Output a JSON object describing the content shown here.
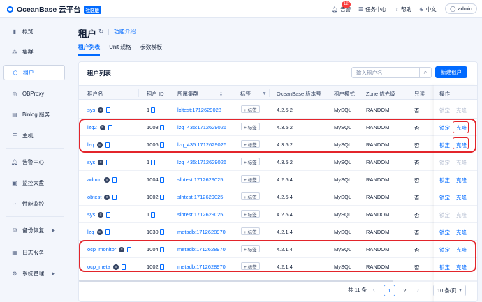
{
  "app": {
    "brand": "OceanBase 云平台",
    "edition_badge": "社区版"
  },
  "header": {
    "alerts_label": "告警",
    "alerts_count": "12",
    "tasks_label": "任务中心",
    "help_label": "帮助",
    "lang_label": "中文",
    "user_label": "admin"
  },
  "sidebar": {
    "items": [
      {
        "label": "概览",
        "icon": "bar-chart-icon"
      },
      {
        "label": "集群",
        "icon": "cluster-icon"
      },
      {
        "label": "租户",
        "icon": "tenant-icon",
        "active": true
      },
      {
        "label": "OBProxy",
        "icon": "proxy-icon"
      },
      {
        "label": "Binlog 服务",
        "icon": "binlog-icon"
      },
      {
        "label": "主机",
        "icon": "host-icon"
      },
      {
        "label": "告警中心",
        "icon": "bell-icon"
      },
      {
        "label": "监控大盘",
        "icon": "monitor-icon"
      },
      {
        "label": "性能监控",
        "icon": "performance-icon"
      },
      {
        "label": "备份恢复",
        "icon": "backup-icon",
        "expandable": true
      },
      {
        "label": "日志服务",
        "icon": "log-icon"
      },
      {
        "label": "系统管理",
        "icon": "settings-icon",
        "expandable": true
      }
    ]
  },
  "page": {
    "title": "租户",
    "feature_intro": "功能介绍",
    "tabs": [
      "租户列表",
      "Unit 规格",
      "参数模板"
    ]
  },
  "card": {
    "title": "租户列表",
    "search_placeholder": "输入租户名",
    "new_button": "新建租户"
  },
  "table": {
    "columns": [
      "租户名",
      "租户 ID",
      "所属集群",
      "标签",
      "OceanBase 版本号",
      "租户模式",
      "Zone 优先级",
      "只读",
      "操作"
    ],
    "tag_button": "+ 标签",
    "rows": [
      {
        "name": "sys",
        "id": "1",
        "cluster": "lxltest:1712629028",
        "version": "4.2.5.2",
        "mode": "MySQL",
        "zone": "RANDOM",
        "readonly": "否",
        "lock": "锁定",
        "clone": "克隆",
        "enabled": false
      },
      {
        "name": "lzq2",
        "id": "1008",
        "cluster": "lzq_435:1712629026",
        "version": "4.3.5.2",
        "mode": "MySQL",
        "zone": "RANDOM",
        "readonly": "否",
        "lock": "锁定",
        "clone": "克隆",
        "enabled": true
      },
      {
        "name": "lzq",
        "id": "1006",
        "cluster": "lzq_435:1712629026",
        "version": "4.3.5.2",
        "mode": "MySQL",
        "zone": "RANDOM",
        "readonly": "否",
        "lock": "锁定",
        "clone": "克隆",
        "enabled": true
      },
      {
        "name": "sys",
        "id": "1",
        "cluster": "lzq_435:1712629026",
        "version": "4.3.5.2",
        "mode": "MySQL",
        "zone": "RANDOM",
        "readonly": "否",
        "lock": "锁定",
        "clone": "克隆",
        "enabled": false
      },
      {
        "name": "admin",
        "id": "1004",
        "cluster": "slhtest:1712629025",
        "version": "4.2.5.4",
        "mode": "MySQL",
        "zone": "RANDOM",
        "readonly": "否",
        "lock": "锁定",
        "clone": "克隆",
        "enabled": true
      },
      {
        "name": "obtest",
        "id": "1002",
        "cluster": "slhtest:1712629025",
        "version": "4.2.5.4",
        "mode": "MySQL",
        "zone": "RANDOM",
        "readonly": "否",
        "lock": "锁定",
        "clone": "克隆",
        "enabled": true
      },
      {
        "name": "sys",
        "id": "1",
        "cluster": "slhtest:1712629025",
        "version": "4.2.5.4",
        "mode": "MySQL",
        "zone": "RANDOM",
        "readonly": "否",
        "lock": "锁定",
        "clone": "克隆",
        "enabled": false
      },
      {
        "name": "lzq",
        "id": "1030",
        "cluster": "metadb:1712628970",
        "version": "4.2.1.4",
        "mode": "MySQL",
        "zone": "RANDOM",
        "readonly": "否",
        "lock": "锁定",
        "clone": "克隆",
        "enabled": true
      },
      {
        "name": "ocp_monitor",
        "id": "1004",
        "cluster": "metadb:1712628970",
        "version": "4.2.1.4",
        "mode": "MySQL",
        "zone": "RANDOM",
        "readonly": "否",
        "lock": "锁定",
        "clone": "克隆",
        "enabled": true
      },
      {
        "name": "ocp_meta",
        "id": "1002",
        "cluster": "metadb:1712628970",
        "version": "4.2.1.4",
        "mode": "MySQL",
        "zone": "RANDOM",
        "readonly": "否",
        "lock": "锁定",
        "clone": "克隆",
        "enabled": true
      }
    ]
  },
  "pagination": {
    "total": "共 11 条",
    "pages": [
      "1",
      "2"
    ],
    "current": "1",
    "page_size": "10 条/页"
  },
  "colors": {
    "accent": "#006aff",
    "highlight": "#e3252b"
  }
}
